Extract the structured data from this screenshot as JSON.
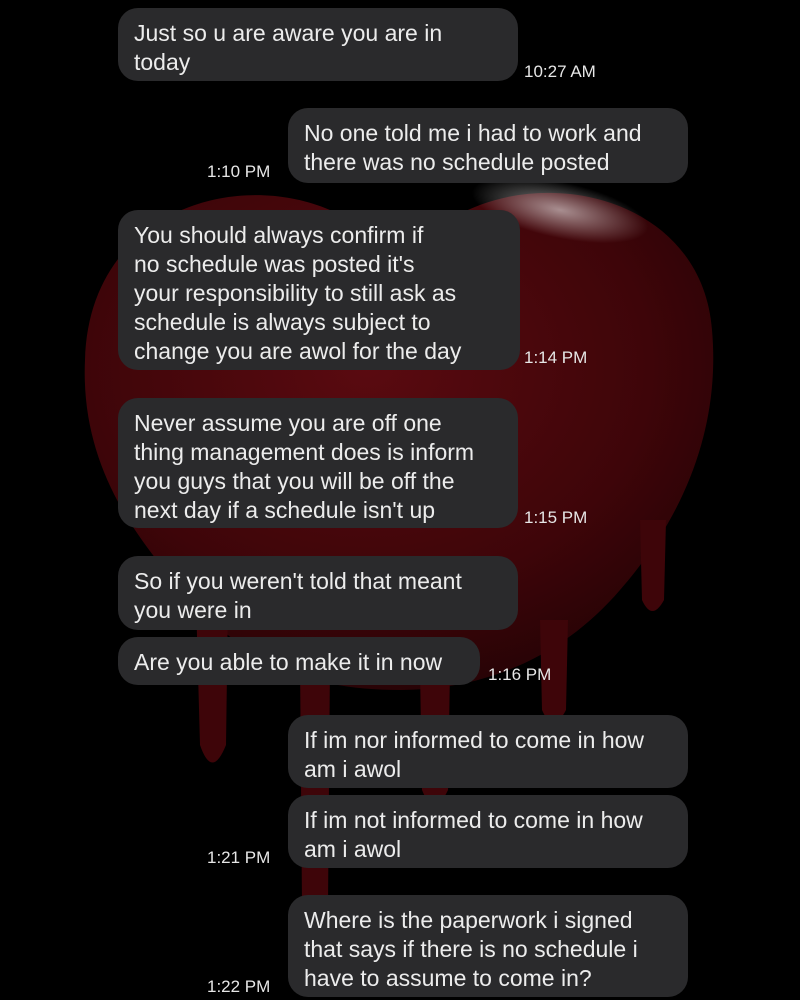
{
  "wallpaper": {
    "icon": "melting-heart-icon",
    "color": "#3e0509"
  },
  "messages": [
    {
      "direction": "incoming",
      "text": "Just so u are aware you are in\ntoday"
    },
    {
      "direction": "outgoing",
      "text": "No one told me i had to work and\nthere was no schedule posted"
    },
    {
      "direction": "incoming",
      "text": "You should always confirm if\nno schedule was posted it's\nyour responsibility to still ask as\nschedule is always subject to\nchange you are awol for the day"
    },
    {
      "direction": "incoming",
      "text": "Never assume you are off one\nthing management does is inform\nyou guys that you will be off the\nnext day if a schedule isn't up"
    },
    {
      "direction": "incoming",
      "text": "So if you weren't told that meant\nyou were in"
    },
    {
      "direction": "incoming",
      "text": "Are you able to make it in now"
    },
    {
      "direction": "outgoing",
      "text": "If im nor informed to come in how\nam i awol"
    },
    {
      "direction": "outgoing",
      "text": "If im not informed to come in how\nam i awol"
    },
    {
      "direction": "outgoing",
      "text": "Where is the paperwork i signed\nthat says if there is no schedule i\nhave to assume to come in?"
    }
  ],
  "timestamps": [
    "10:27 AM",
    "1:10 PM",
    "1:14 PM",
    "1:15 PM",
    "1:16 PM",
    "1:21 PM",
    "1:22 PM"
  ]
}
